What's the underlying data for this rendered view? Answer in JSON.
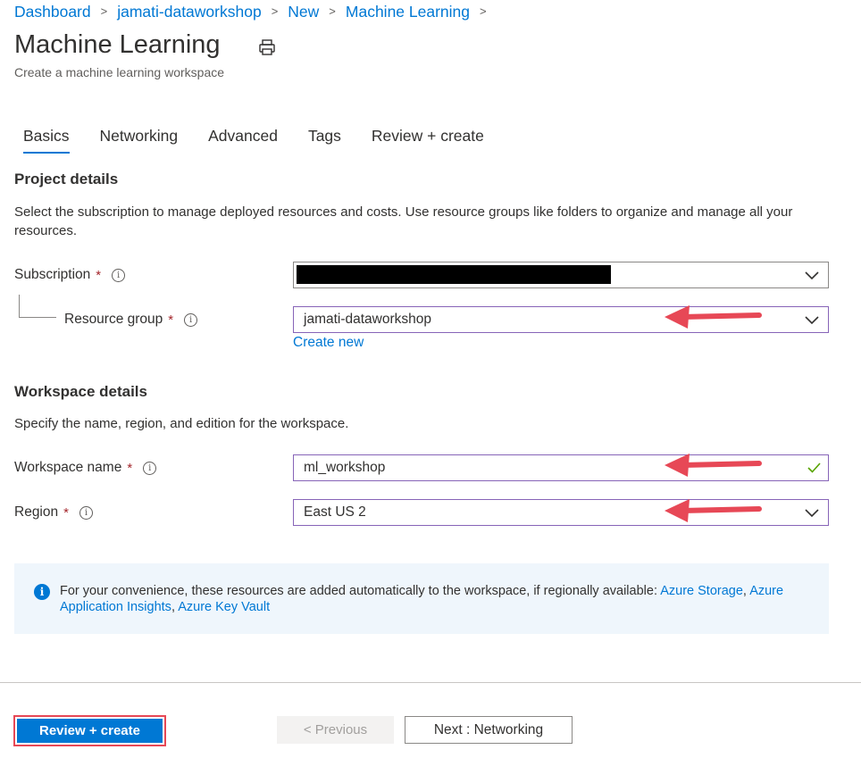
{
  "breadcrumb": [
    "Dashboard",
    "jamati-dataworkshop",
    "New",
    "Machine Learning"
  ],
  "header": {
    "title": "Machine Learning",
    "subtitle": "Create a machine learning workspace"
  },
  "tabs": [
    {
      "label": "Basics",
      "active": true
    },
    {
      "label": "Networking",
      "active": false
    },
    {
      "label": "Advanced",
      "active": false
    },
    {
      "label": "Tags",
      "active": false
    },
    {
      "label": "Review + create",
      "active": false
    }
  ],
  "project": {
    "heading": "Project details",
    "description": "Select the subscription to manage deployed resources and costs. Use resource groups like folders to organize and manage all your resources.",
    "subscription": {
      "label": "Subscription",
      "value": ""
    },
    "resource_group": {
      "label": "Resource group",
      "value": "jamati-dataworkshop",
      "create_new": "Create new"
    }
  },
  "workspace": {
    "heading": "Workspace details",
    "description": "Specify the name, region, and edition for the workspace.",
    "name": {
      "label": "Workspace name",
      "value": "ml_workshop"
    },
    "region": {
      "label": "Region",
      "value": "East US 2"
    }
  },
  "info": {
    "text": "For your convenience, these resources are added automatically to the workspace, if regionally available:",
    "links": [
      "Azure Storage",
      "Azure Application Insights",
      "Azure Key Vault"
    ]
  },
  "footer": {
    "review_create": "Review + create",
    "previous": "< Previous",
    "next": "Next : Networking"
  },
  "required_marker": "*",
  "colors": {
    "accent": "#0078d4",
    "required": "#a4262c",
    "annotation_arrow": "#e74856",
    "valid_check": "#57a300",
    "info_background": "#eff6fc"
  }
}
